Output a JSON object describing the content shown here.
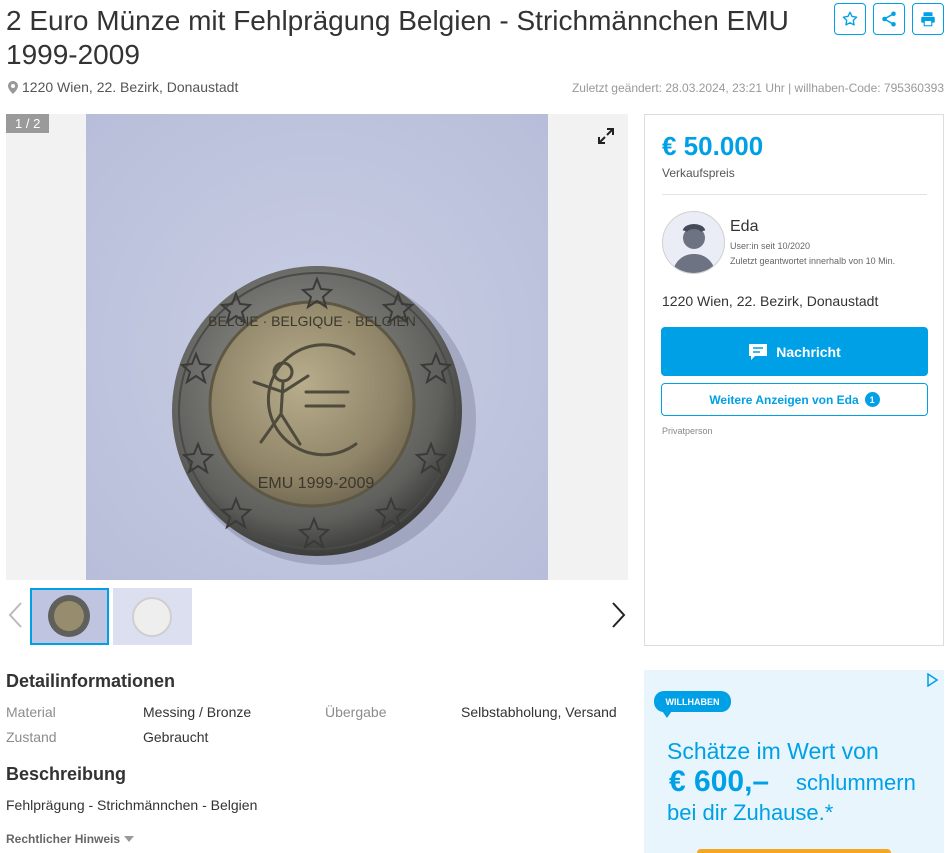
{
  "listing": {
    "title": "2 Euro Münze mit Fehlprägung Belgien - Strichmännchen EMU 1999-2009",
    "location": "1220 Wien, 22. Bezirk, Donaustadt",
    "last_changed": "Zuletzt geändert: 28.03.2024, 23:21 Uhr | willhaben-Code: 795360393"
  },
  "actions": {
    "favorite_icon": "star-icon",
    "share_icon": "share-icon",
    "print_icon": "printer-icon"
  },
  "gallery": {
    "counter": "1 / 2",
    "coin_year_text": "EMU 1999-2009",
    "coin_top_text": "BELGIE - BELGIQUE - BELGIEN"
  },
  "sidebar": {
    "price": "€ 50.000",
    "price_label": "Verkaufspreis",
    "seller_name": "Eda",
    "seller_since": "User:in seit 10/2020",
    "seller_response": "Zuletzt geantwortet innerhalb von 10 Min.",
    "seller_location": "1220 Wien, 22. Bezirk, Donaustadt",
    "message_button": "Nachricht",
    "more_ads_button": "Weitere Anzeigen von Eda",
    "more_ads_count": "1",
    "seller_type": "Privatperson"
  },
  "details": {
    "heading": "Detailinformationen",
    "rows": [
      {
        "label": "Material",
        "value": "Messing / Bronze"
      },
      {
        "label": "Übergabe",
        "value": "Selbstabholung, Versand"
      },
      {
        "label": "Zustand",
        "value": "Gebraucht"
      }
    ]
  },
  "description": {
    "heading": "Beschreibung",
    "text": "Fehlprägung - Strichmännchen - Belgien"
  },
  "legal": {
    "label": "Rechtlicher Hinweis"
  },
  "ad": {
    "logo": "WILLHABEN",
    "line1": "Schätze im Wert von",
    "price": "€ 600,–",
    "line2": "schlummern",
    "line3": "bei dir Zuhause.*"
  },
  "colors": {
    "accent": "#00a0e6",
    "ad_background": "#e8f5fc",
    "ad_button": "#f5a623"
  }
}
